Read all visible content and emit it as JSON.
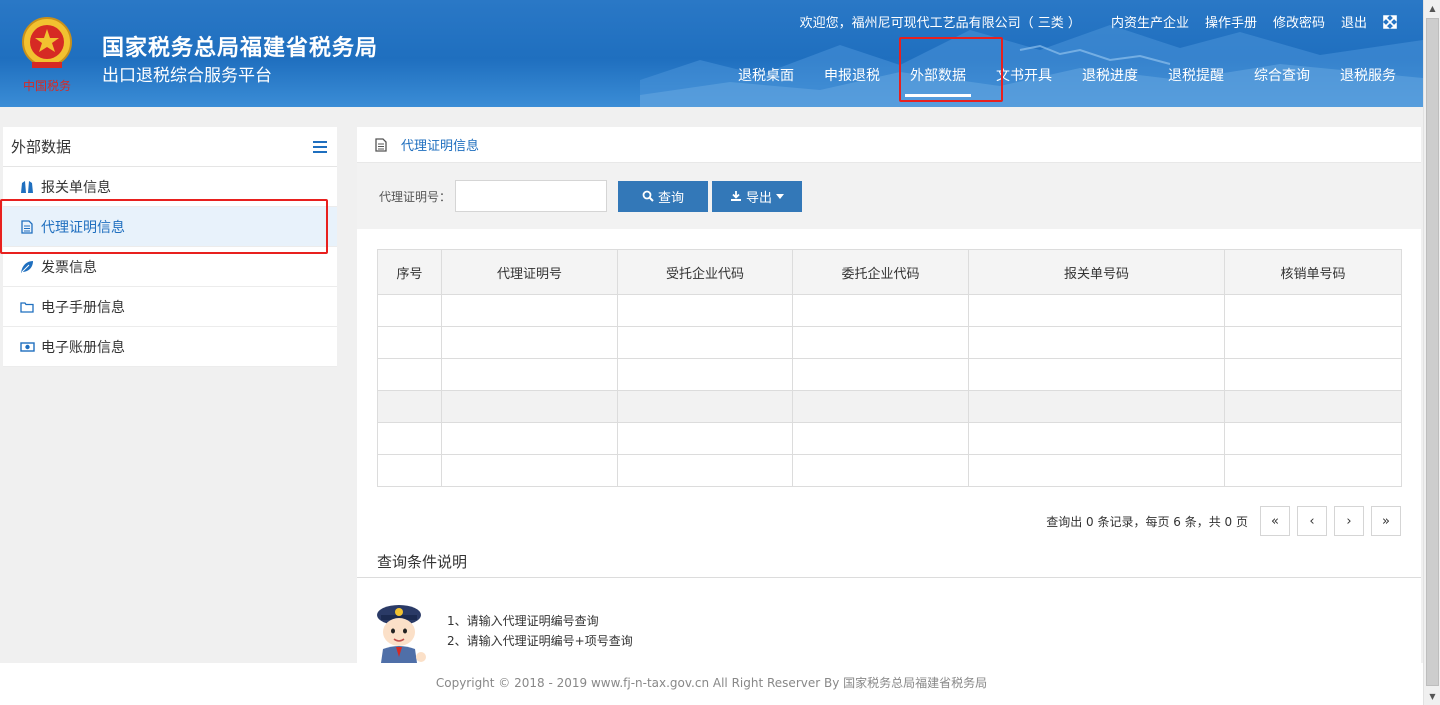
{
  "header": {
    "title": "国家税务总局福建省税务局",
    "subtitle": "出口退税综合服务平台",
    "emblem_text": "中国税务",
    "welcome": "欢迎您，福州尼可现代工艺品有限公司（ 三类 ）",
    "top_links": [
      "内资生产企业",
      "操作手册",
      "修改密码",
      "退出"
    ],
    "nav": [
      "退税桌面",
      "申报退税",
      "外部数据",
      "文书开具",
      "退税进度",
      "退税提醒",
      "综合查询",
      "退税服务"
    ],
    "active_nav": "外部数据"
  },
  "sidebar": {
    "title": "外部数据",
    "items": [
      {
        "label": "报关单信息",
        "icon": "binoculars-icon"
      },
      {
        "label": "代理证明信息",
        "icon": "document-icon"
      },
      {
        "label": "发票信息",
        "icon": "leaf-icon"
      },
      {
        "label": "电子手册信息",
        "icon": "folder-icon"
      },
      {
        "label": "电子账册信息",
        "icon": "money-icon"
      }
    ],
    "active": "代理证明信息"
  },
  "content": {
    "panel_title": "代理证明信息",
    "search": {
      "label": "代理证明号：",
      "value": "",
      "query_button": "查询",
      "export_button": "导出"
    },
    "table": {
      "columns": [
        "序号",
        "代理证明号",
        "受托企业代码",
        "委托企业代码",
        "报关单号码",
        "核销单号码"
      ],
      "rows": [
        [
          "",
          "",
          "",
          "",
          "",
          ""
        ],
        [
          "",
          "",
          "",
          "",
          "",
          ""
        ],
        [
          "",
          "",
          "",
          "",
          "",
          ""
        ],
        [
          "",
          "",
          "",
          "",
          "",
          ""
        ],
        [
          "",
          "",
          "",
          "",
          "",
          ""
        ],
        [
          "",
          "",
          "",
          "",
          "",
          ""
        ]
      ]
    },
    "pager": {
      "info": "查询出 0 条记录，每页 6 条，共 0 页",
      "first": "«",
      "prev": "‹",
      "next": "›",
      "last": "»"
    },
    "conditions": {
      "title": "查询条件说明",
      "tips": [
        "1、请输入代理证明编号查询",
        "2、请输入代理证明编号+项号查询"
      ]
    }
  },
  "footer": {
    "text": "Copyright © 2018 - 2019 www.fj-n-tax.gov.cn All Right Reserver By 国家税务总局福建省税务局"
  },
  "colors": {
    "header_blue": "#1f6fbf",
    "button_blue": "#3378b8",
    "annotation_red": "#e8201e",
    "active_row_bg": "#e8f2fb"
  }
}
